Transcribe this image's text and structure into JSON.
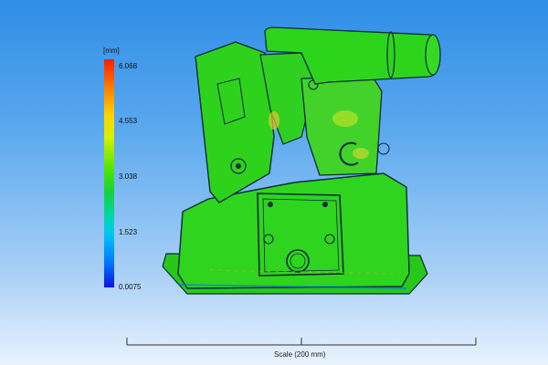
{
  "legend": {
    "unit": "[mm]",
    "labels": [
      "6.068",
      "4.553",
      "3.038",
      "1.523",
      "0.0075"
    ],
    "colors": {
      "max": "#ff1a00",
      "high": "#ffd000",
      "mid": "#15d23a",
      "low": "#00c8f0",
      "min": "#0a14e0"
    }
  },
  "scale": {
    "label": "Scale (200 mm)"
  },
  "model": {
    "fill_color": "#2fd41e",
    "outline_color": "#0b2a3a"
  }
}
